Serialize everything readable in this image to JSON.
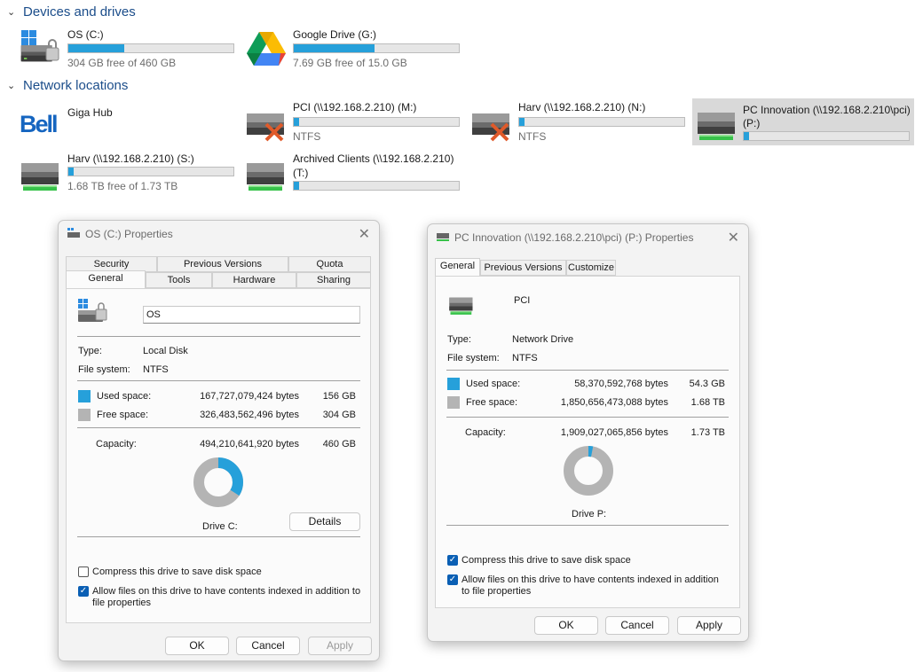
{
  "explorer": {
    "devices_title": "Devices and drives",
    "network_title": "Network locations",
    "devices": [
      {
        "name": "OS (C:)",
        "free_text": "304 GB free of 460 GB",
        "used_fraction": 0.34,
        "icon": "windows-drive-icon"
      },
      {
        "name": "Google Drive (G:)",
        "free_text": "7.69 GB free of 15.0 GB",
        "used_fraction": 0.49,
        "icon": "google-drive-icon"
      }
    ],
    "network": [
      {
        "name": "Giga Hub",
        "icon": "bell-logo-icon"
      },
      {
        "name": "PCI (\\\\192.168.2.210) (M:)",
        "free_text": "NTFS",
        "used_fraction": 0.03,
        "icon": "disconnected-network-drive-icon"
      },
      {
        "name": "Harv (\\\\192.168.2.210) (N:)",
        "free_text": "NTFS",
        "used_fraction": 0.03,
        "icon": "disconnected-network-drive-icon"
      },
      {
        "name": "PC Innovation (\\\\192.168.2.210\\pci)",
        "name2": "(P:)",
        "used_fraction": 0.03,
        "icon": "network-drive-icon"
      },
      {
        "name": "Harv (\\\\192.168.2.210) (S:)",
        "free_text": "1.68 TB free of 1.73 TB",
        "used_fraction": 0.03,
        "icon": "network-drive-icon"
      },
      {
        "name": "Archived Clients (\\\\192.168.2.210)",
        "name2": "(T:)",
        "used_fraction": 0.03,
        "icon": "network-drive-icon"
      }
    ]
  },
  "dialog_c": {
    "title": "OS (C:) Properties",
    "tabs_row1": [
      "Security",
      "Previous Versions",
      "Quota"
    ],
    "tabs_row2": [
      "General",
      "Tools",
      "Hardware",
      "Sharing"
    ],
    "label_value": "OS",
    "type_label": "Type:",
    "type_value": "Local Disk",
    "fs_label": "File system:",
    "fs_value": "NTFS",
    "used_label": "Used space:",
    "used_bytes": "167,727,079,424 bytes",
    "used_gb": "156 GB",
    "free_label": "Free space:",
    "free_bytes": "326,483,562,496 bytes",
    "free_gb": "304 GB",
    "cap_label": "Capacity:",
    "cap_bytes": "494,210,641,920 bytes",
    "cap_gb": "460 GB",
    "drive_label": "Drive C:",
    "details_button": "Details",
    "compress_label": "Compress this drive to save disk space",
    "index_label_1": "Allow files on this drive to have contents indexed in addition to",
    "index_label_2": "file properties",
    "ok": "OK",
    "cancel": "Cancel",
    "apply": "Apply",
    "used_fraction": 0.34
  },
  "dialog_p": {
    "title": "PC Innovation (\\\\192.168.2.210\\pci) (P:) Properties",
    "tabs": [
      "General",
      "Previous Versions",
      "Customize"
    ],
    "label_value": "PCI",
    "type_label": "Type:",
    "type_value": "Network Drive",
    "fs_label": "File system:",
    "fs_value": "NTFS",
    "used_label": "Used space:",
    "used_bytes": "58,370,592,768 bytes",
    "used_gb": "54.3 GB",
    "free_label": "Free space:",
    "free_bytes": "1,850,656,473,088 bytes",
    "free_gb": "1.68 TB",
    "cap_label": "Capacity:",
    "cap_bytes": "1,909,027,065,856 bytes",
    "cap_gb": "1.73 TB",
    "drive_label": "Drive P:",
    "compress_label": "Compress this drive to save disk space",
    "index_label_1": "Allow files on this drive to have contents indexed in addition",
    "index_label_2": "to file properties",
    "ok": "OK",
    "cancel": "Cancel",
    "apply": "Apply",
    "used_fraction": 0.03
  },
  "colors": {
    "used": "#26a0da",
    "free": "#b4b4b4",
    "accent": "#0a5fb4"
  }
}
